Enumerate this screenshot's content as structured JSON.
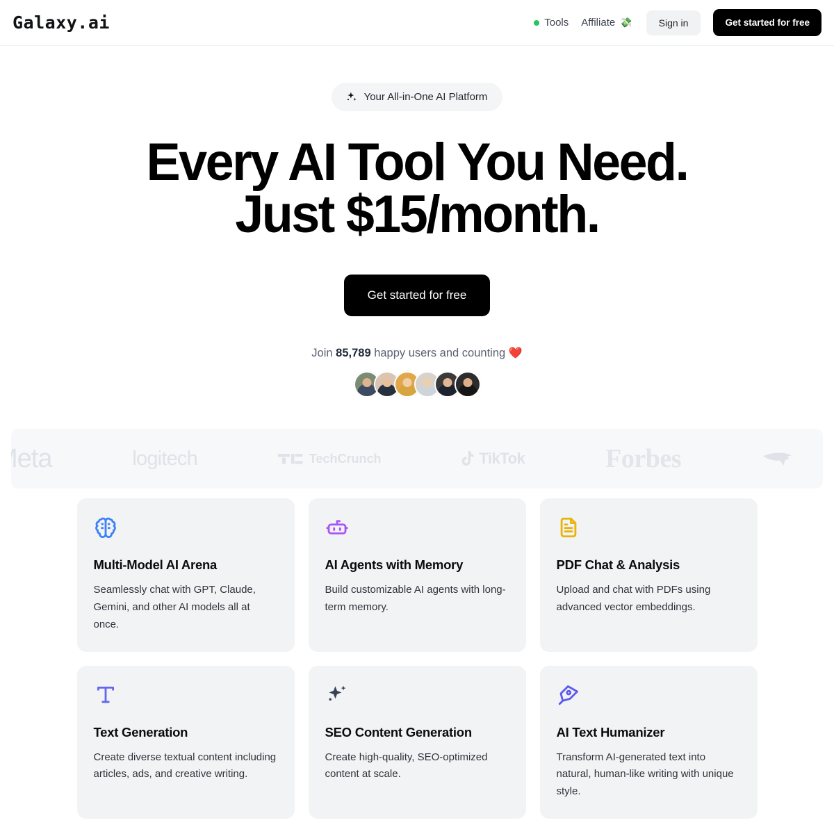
{
  "header": {
    "logo": "Galaxy.ai",
    "nav": [
      {
        "label": "Tools",
        "icon": "green-status-dot"
      },
      {
        "label": "Affiliate",
        "emoji": "💸"
      }
    ],
    "sign_in_label": "Sign in",
    "cta_label": "Get started for free"
  },
  "hero": {
    "badge_text": "Your All-in-One AI Platform",
    "badge_icon": "sparkles-icon",
    "headline_line1": "Every AI Tool You Need.",
    "headline_line2": "Just $15/month.",
    "cta_label": "Get started for free",
    "social_proof_prefix": "Join ",
    "social_proof_count": "85,789",
    "social_proof_suffix": " happy users and counting ",
    "social_proof_emoji": "❤️",
    "avatars": [
      {
        "name": "user-avatar-1",
        "bg": "#7c8b74",
        "skin": "#e0b48f",
        "body": "#3c4a63"
      },
      {
        "name": "user-avatar-2",
        "bg": "#d9c5b2",
        "skin": "#e8c09b",
        "body": "#26303f"
      },
      {
        "name": "user-avatar-3",
        "bg": "#e0a849",
        "skin": "#f0cfa6",
        "body": "#d8a43f"
      },
      {
        "name": "user-avatar-4",
        "bg": "#d7d2cb",
        "skin": "#eccfae",
        "body": "#cfd4d8"
      },
      {
        "name": "user-avatar-5",
        "bg": "#3a3a3a",
        "skin": "#e3b793",
        "body": "#1d2230"
      },
      {
        "name": "user-avatar-6",
        "bg": "#2c2c2c",
        "skin": "#dcae8a",
        "body": "#151515"
      }
    ]
  },
  "logo_strip": {
    "brands": [
      {
        "name": "meta",
        "label": "Meta"
      },
      {
        "name": "logitech",
        "label": "logitech"
      },
      {
        "name": "techcrunch",
        "label": "TechCrunch"
      },
      {
        "name": "tiktok",
        "label": "TikTok"
      },
      {
        "name": "forbes",
        "label": "Forbes"
      },
      {
        "name": "new-england-patriots",
        "label": ""
      }
    ]
  },
  "features": {
    "cards": [
      {
        "icon": "brain-icon",
        "color": "#3b82f6",
        "title": "Multi-Model AI Arena",
        "desc": "Seamlessly chat with GPT, Claude, Gemini, and other AI models all at once."
      },
      {
        "icon": "robot-icon",
        "color": "#a855f7",
        "title": "AI Agents with Memory",
        "desc": "Build customizable AI agents with long-term memory."
      },
      {
        "icon": "file-text-icon",
        "color": "#eab308",
        "title": "PDF Chat & Analysis",
        "desc": "Upload and chat with PDFs using advanced vector embeddings."
      },
      {
        "icon": "type-icon",
        "color": "#6366f1",
        "title": "Text Generation",
        "desc": "Create diverse textual content including articles, ads, and creative writing."
      },
      {
        "icon": "sparkles-icon",
        "color": "#374151",
        "title": "SEO Content Generation",
        "desc": "Create high-quality, SEO-optimized content at scale."
      },
      {
        "icon": "pen-nib-icon",
        "color": "#5b5bef",
        "title": "AI Text Humanizer",
        "desc": "Transform AI-generated text into natural, human-like writing with unique style."
      }
    ]
  }
}
